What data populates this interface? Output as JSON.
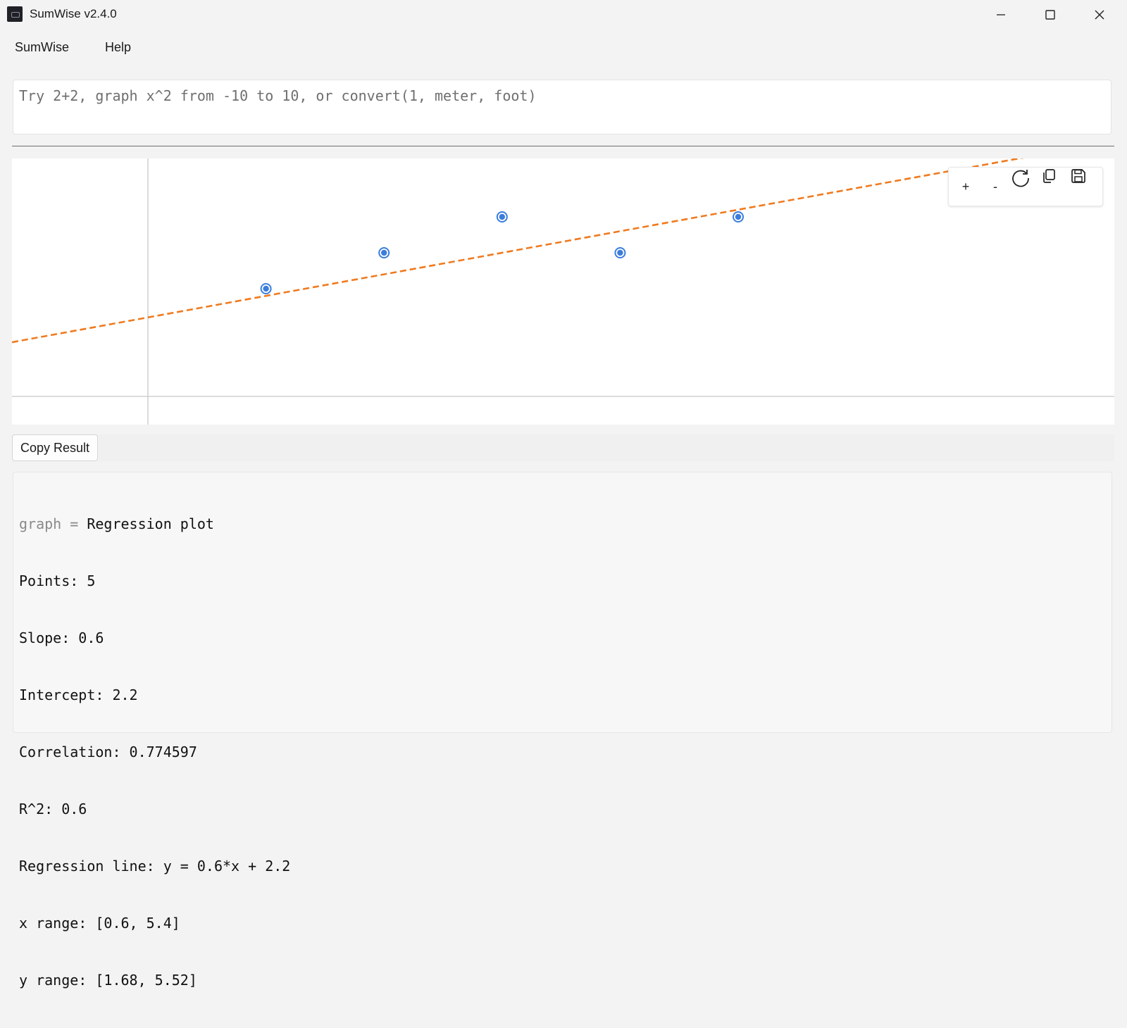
{
  "window": {
    "title": "SumWise v2.4.0",
    "app_icon": "sumwise-app-icon",
    "controls": [
      "minimize-icon",
      "maximize-icon",
      "close-icon"
    ]
  },
  "menu": {
    "items": [
      "SumWise",
      "Help"
    ]
  },
  "expression": {
    "value": "",
    "placeholder": "Try 2+2, graph x^2 from -10 to 10, or convert(1, meter, foot)"
  },
  "graph_toolbar": {
    "zoom_in_label": "+",
    "zoom_out_label": "-",
    "icons": [
      "refresh-icon",
      "copy-icon",
      "save-icon"
    ]
  },
  "copy_button": {
    "label": "Copy Result"
  },
  "result": {
    "prefix_var": "graph",
    "prefix_eq": " = ",
    "headline": "Regression plot",
    "lines": [
      "Points: 5",
      "Slope: 0.6",
      "Intercept: 2.2",
      "Correlation: 0.774597",
      "R^2: 0.6",
      "Regression line: y = 0.6*x + 2.2",
      "x range: [0.6, 5.4]",
      "y range: [1.68, 5.52]"
    ]
  },
  "colors": {
    "points": "#3b7ddd",
    "regression_line": "#f07a1e",
    "axes": "#c8c8c8"
  },
  "chart_data": {
    "type": "scatter",
    "series": [
      {
        "name": "",
        "x": [
          1,
          2,
          3,
          4,
          5
        ],
        "y": [
          3,
          4,
          5,
          4,
          5
        ]
      }
    ],
    "regression": {
      "slope": 0.6,
      "intercept": 2.2
    },
    "xlim": [
      0.6,
      5.4
    ],
    "ylim": [
      1.68,
      5.52
    ],
    "grid": false
  }
}
